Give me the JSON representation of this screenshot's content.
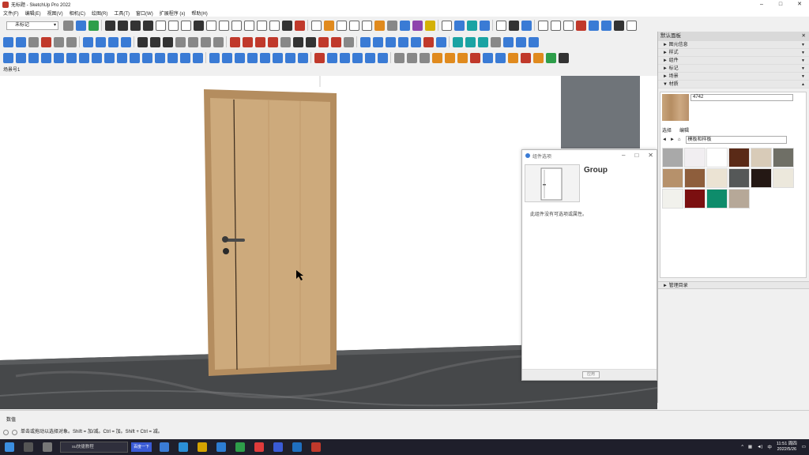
{
  "window": {
    "title": "无标题 - SketchUp Pro 2022",
    "ctrl_min": "–",
    "ctrl_max": "□",
    "ctrl_close": "✕"
  },
  "menubar": {
    "items": [
      "文件(F)",
      "编辑(E)",
      "视图(V)",
      "相机(C)",
      "绘图(R)",
      "工具(T)",
      "窗口(W)",
      "扩展程序 (x)",
      "帮助(H)"
    ]
  },
  "toolbar": {
    "layer_value": "未标记"
  },
  "scene": {
    "tab_label": "场景号1"
  },
  "dialog": {
    "title": "组件选项",
    "ctrl_min": "–",
    "ctrl_max": "□",
    "ctrl_close": "✕",
    "group_name": "Group",
    "message": "此组件没有可选项或属性。",
    "apply_button": "应用"
  },
  "tray": {
    "title": "默认面板",
    "close": "✕",
    "sections": [
      "图元信息",
      "样式",
      "组件",
      "标记",
      "场景"
    ],
    "materials_section": "材质",
    "material_name": "4742",
    "tab_select": "选择",
    "tab_edit": "编辑",
    "library": "模板和样板",
    "bottom_section": "管理目录",
    "swatches": [
      "#a9a9a9",
      "#f1eef1",
      "#ffffff",
      "#5a2a17",
      "#d8cbb8",
      "#6f6f66",
      "#b6916b",
      "#8e5e3c",
      "#ebe3d3",
      "#555858",
      "#241814",
      "#ece8dc",
      "#f1f1ec",
      "#7b0f10",
      "#0e8c6b",
      "#b6a898"
    ]
  },
  "measure": {
    "label": "数值"
  },
  "status": {
    "text": "单击或拖动以选择对象。Shift = 加/减。Ctrl = 加。Shift + Ctrl = 减。"
  },
  "taskbar": {
    "search_placeholder": "su快捷教程",
    "baidu_label": "百度一下",
    "time": "11:51 周四",
    "date": "2022/5/26"
  }
}
